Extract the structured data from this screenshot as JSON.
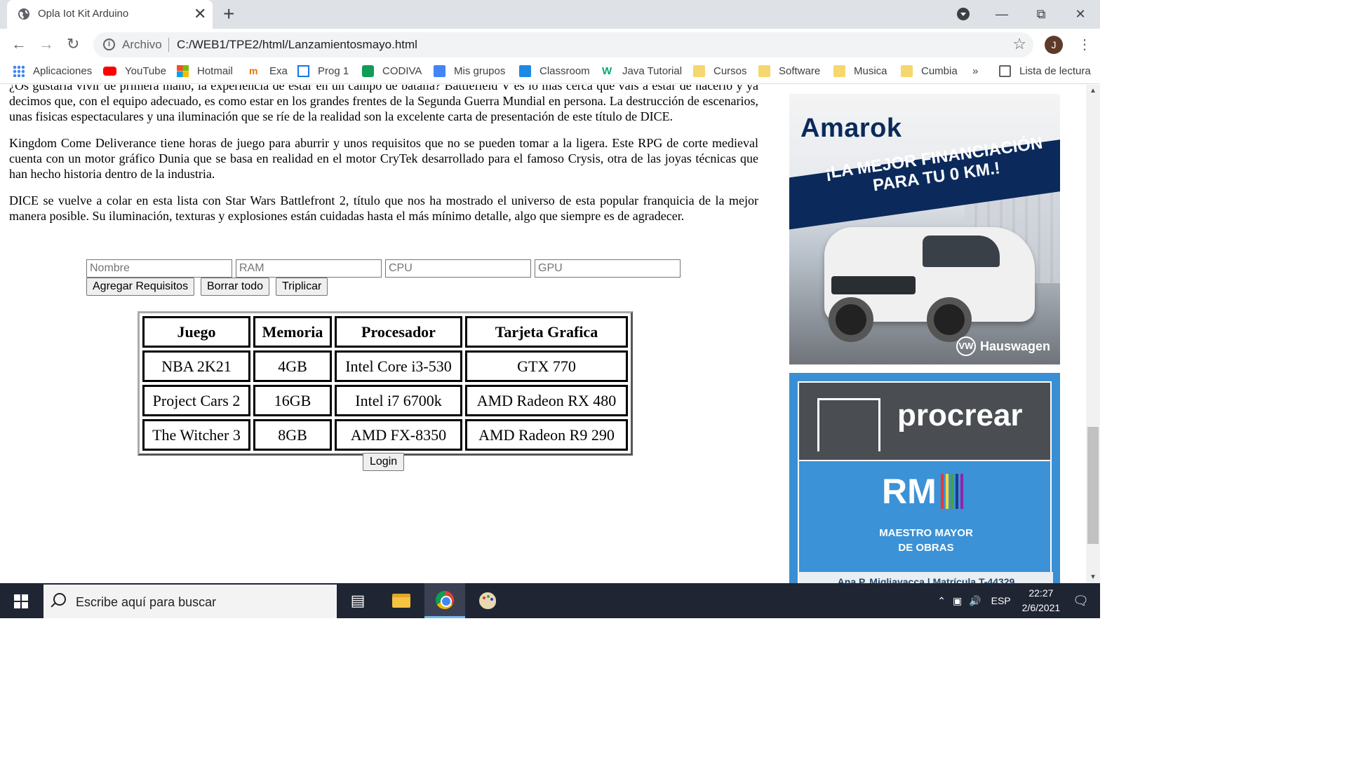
{
  "browser": {
    "tab_title": "Opla Iot Kit Arduino",
    "tab_close": "✕",
    "new_tab": "+",
    "address_prefix": "Archivo",
    "url": "C:/WEB1/TPE2/html/Lanzamientosmayo.html",
    "profile_initial": "J"
  },
  "bookmarks": [
    {
      "label": "Aplicaciones",
      "icon": "apps-grid-icon",
      "color": "#4285f4"
    },
    {
      "label": "YouTube",
      "icon": "youtube-icon",
      "color": "#ff0000"
    },
    {
      "label": "Hotmail",
      "icon": "microsoft-icon",
      "color": "#f25022"
    },
    {
      "label": "Exa",
      "icon": "exa-icon",
      "color": "#e8710a"
    },
    {
      "label": "Prog 1",
      "icon": "calendar-icon",
      "color": "#1a73e8"
    },
    {
      "label": "CODIVA",
      "icon": "codiva-icon",
      "color": "#0f9d58"
    },
    {
      "label": "Mis grupos",
      "icon": "groups-icon",
      "color": "#4285f4"
    },
    {
      "label": "Classroom",
      "icon": "classroom-icon",
      "color": "#1e88e5"
    },
    {
      "label": "Java Tutorial",
      "icon": "w3schools-icon",
      "color": "#04aa6d"
    },
    {
      "label": "Cursos",
      "icon": "folder-icon",
      "color": "#f5d76e"
    },
    {
      "label": "Software",
      "icon": "folder-icon",
      "color": "#f5d76e"
    },
    {
      "label": "Musica",
      "icon": "folder-icon",
      "color": "#f5d76e"
    },
    {
      "label": "Cumbia",
      "icon": "folder-icon",
      "color": "#f5d76e"
    }
  ],
  "bookmarks_more": "»",
  "reading_list": "Lista de lectura",
  "article": {
    "p1": "¿Os gustaría vivir de primera mano, la experiencia de estar en un campo de batalla? Battlefield V es lo más cerca que vais a estar de hacerlo y ya decimos que, con el equipo adecuado, es como estar en los grandes frentes de la Segunda Guerra Mundial en persona. La destrucción de escenarios, unas fisicas espectaculares y una iluminación que se ríe de la realidad son la excelente carta de presentación de este título de DICE.",
    "p2": "Kingdom Come Deliverance tiene horas de juego para aburrir y unos requisitos que no se pueden tomar a la ligera. Este RPG de corte medieval cuenta con un motor gráfico Dunia que se basa en realidad en el motor CryTek desarrollado para el famoso Crysis, otra de las joyas técnicas que han hecho historia dentro de la industria.",
    "p3": "DICE se vuelve a colar en esta lista con Star Wars Battlefront 2, título que nos ha mostrado el universo de esta popular franquicia de la mejor manera posible. Su iluminación, texturas y explosiones están cuidadas hasta el más mínimo detalle, algo que siempre es de agradecer."
  },
  "form": {
    "placeholders": {
      "nombre": "Nombre",
      "ram": "RAM",
      "cpu": "CPU",
      "gpu": "GPU"
    },
    "buttons": {
      "agregar": "Agregar Requisitos",
      "borrar": "Borrar todo",
      "triplicar": "Triplicar"
    }
  },
  "table": {
    "headers": [
      "Juego",
      "Memoria",
      "Procesador",
      "Tarjeta Grafica"
    ],
    "rows": [
      [
        "NBA 2K21",
        "4GB",
        "Intel Core i3-530",
        "GTX 770"
      ],
      [
        "Project Cars 2",
        "16GB",
        "Intel i7 6700k",
        "AMD Radeon RX 480"
      ],
      [
        "The Witcher 3",
        "8GB",
        "AMD FX-8350",
        "AMD Radeon R9 290"
      ]
    ]
  },
  "login_label": "Login",
  "ads": {
    "ad1": {
      "title": "Amarok",
      "banner": "¡LA MEJOR FINANCIACIÓN PARA TU 0 KM.!",
      "dealer": "Hauswagen",
      "accent": "#0b2a5b"
    },
    "ad2": {
      "title": "procrear",
      "logo": "RM",
      "line1": "MAESTRO MAYOR",
      "line2": "DE OBRAS",
      "footer": "Ana P. Migliavacca | Matrícula T-44329",
      "accent": "#3b92d6"
    }
  },
  "taskbar": {
    "search_placeholder": "Escribe aquí para buscar",
    "language": "ESP",
    "time": "22:27",
    "date": "2/6/2021"
  }
}
